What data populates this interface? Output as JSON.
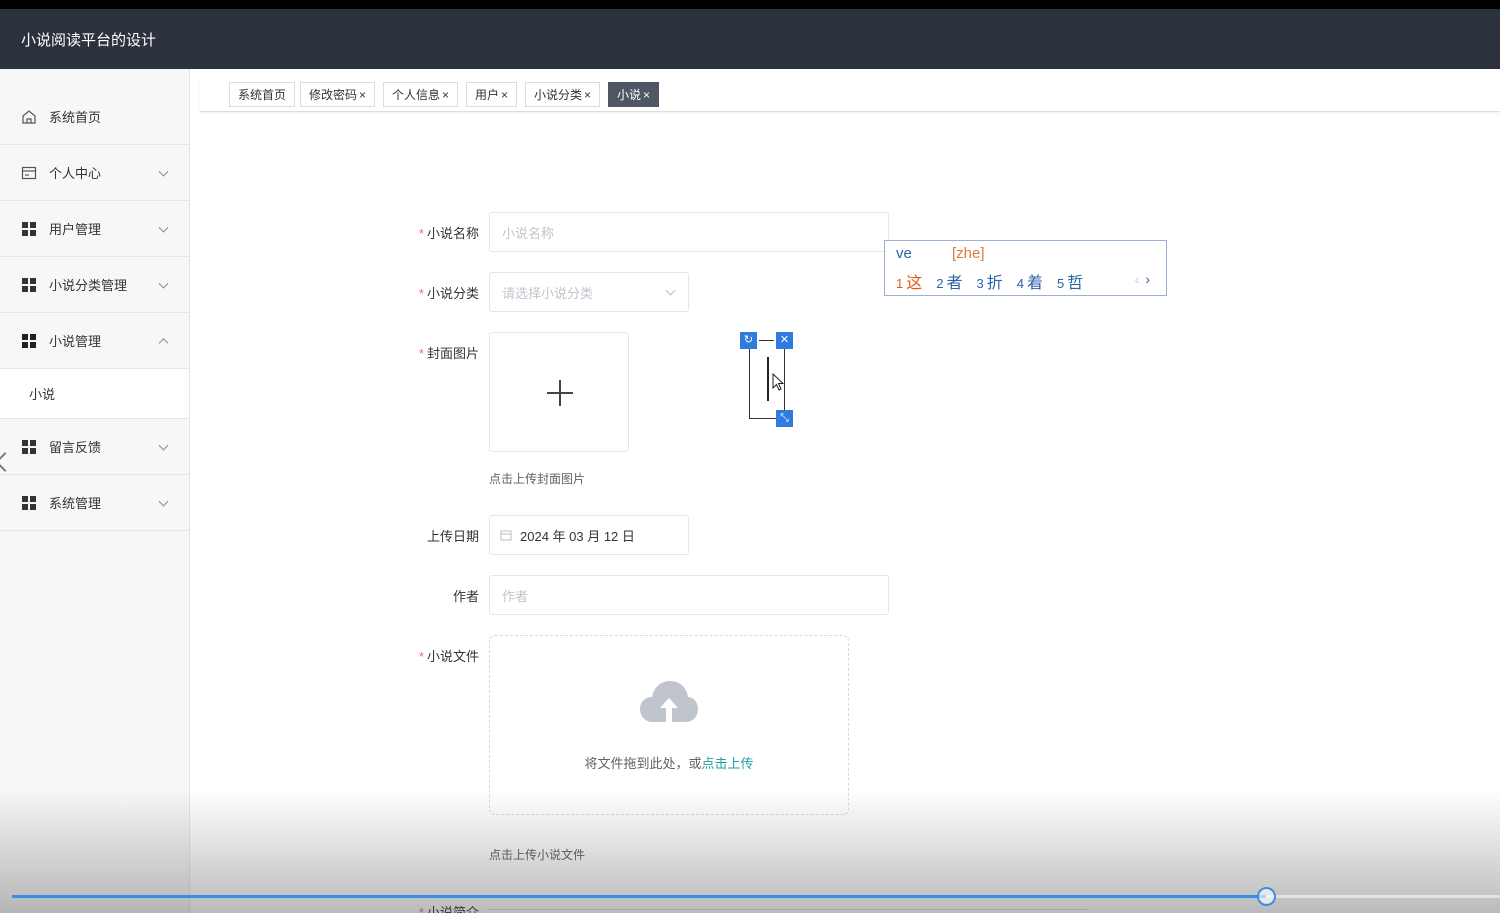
{
  "app": {
    "title": "小说阅读平台的设计"
  },
  "sidebar": {
    "items": [
      {
        "label": "系统首页",
        "icon": "home-icon"
      },
      {
        "label": "个人中心",
        "icon": "card-icon"
      },
      {
        "label": "用户管理",
        "icon": "grid-icon"
      },
      {
        "label": "小说分类管理",
        "icon": "grid-icon"
      },
      {
        "label": "小说管理",
        "icon": "grid-icon"
      },
      {
        "label": "留言反馈",
        "icon": "grid-icon"
      },
      {
        "label": "系统管理",
        "icon": "grid-icon"
      }
    ],
    "subitems": [
      {
        "label": "小说"
      }
    ]
  },
  "tabs": [
    {
      "label": "系统首页",
      "closable": false
    },
    {
      "label": "修改密码",
      "closable": true
    },
    {
      "label": "个人信息",
      "closable": true
    },
    {
      "label": "用户",
      "closable": true
    },
    {
      "label": "小说分类",
      "closable": true
    },
    {
      "label": "小说",
      "closable": true,
      "active": true
    }
  ],
  "tab_close_glyph": "×",
  "form": {
    "required_mark": "*",
    "name": {
      "label": "小说名称",
      "placeholder": "小说名称"
    },
    "category": {
      "label": "小说分类",
      "placeholder": "请选择小说分类"
    },
    "cover": {
      "label": "封面图片",
      "hint": "点击上传封面图片"
    },
    "upload_date": {
      "label": "上传日期",
      "value": "2024 年 03 月 12 日"
    },
    "author": {
      "label": "作者",
      "placeholder": "作者"
    },
    "file": {
      "label": "小说文件",
      "drop_text": "将文件拖到此处，或",
      "drop_link": "点击上传",
      "hint": "点击上传小说文件"
    },
    "intro": {
      "label": "小说简介"
    }
  },
  "ime": {
    "typed": "ve",
    "pinyin": "[zhe]",
    "candidates": [
      {
        "n": "1",
        "c": "这"
      },
      {
        "n": "2",
        "c": "者"
      },
      {
        "n": "3",
        "c": "折"
      },
      {
        "n": "4",
        "c": "着"
      },
      {
        "n": "5",
        "c": "哲"
      }
    ],
    "prev": "‹",
    "next": "›"
  },
  "video_progress": {
    "fraction": 0.843
  },
  "colors": {
    "header": "#2b323d",
    "accent": "#3a8ee6",
    "required": "#f56c6c",
    "active_tab": "#4e5763",
    "link": "#20a0a0"
  }
}
